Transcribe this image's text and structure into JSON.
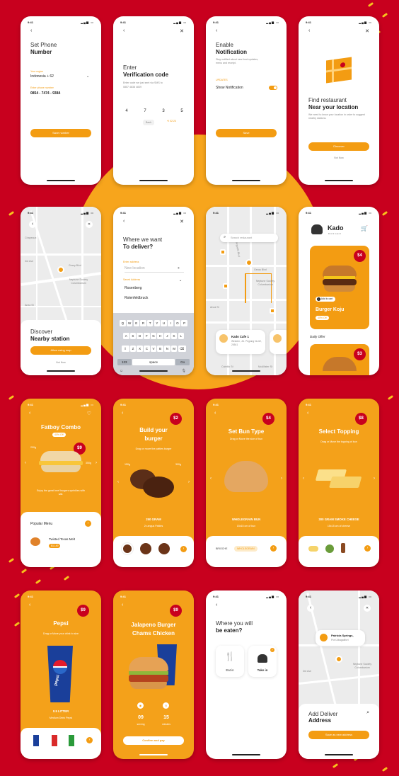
{
  "colors": {
    "background": "#c8001e",
    "accent": "#f39c12",
    "sun": "#f7a51c"
  },
  "status_time": "9:41",
  "p1": {
    "title1": "Set Phone",
    "title2": "Number",
    "region_label": "Your region",
    "region_value": "Indonesia + 62",
    "phone_label": "Enter phone number",
    "phone_value": "0854 - 7474 - 9384",
    "button": "Save number"
  },
  "p2": {
    "title1": "Enter",
    "title2": "Verification code",
    "desc": "Enter code we just sent via SMS to",
    "phone": "0857 4838 4839",
    "digits": [
      "4",
      "7",
      "3",
      "5"
    ],
    "back": "Back",
    "timer": "02:24"
  },
  "p3": {
    "title1": "Enable",
    "title2": "Notification",
    "desc": "Stay notified about new food updates, menu and receipt.",
    "section": "UPDATES",
    "toggle_label": "Show Notification",
    "button": "Save"
  },
  "p4": {
    "title1": "Find restaurant",
    "title2": "Near your location",
    "desc": "We need to know your location in order to suggest nearby stations.",
    "button": "Discover",
    "link": "Not Now"
  },
  "p5": {
    "streets": [
      "Chapeaux",
      "Geary Blvd",
      "Neptune Society Columbarium",
      "3rd Ave",
      "2nd Ave",
      "Anza St"
    ],
    "title1": "Discover",
    "title2": "Nearby station",
    "button": "Allow using map",
    "link": "Not Now"
  },
  "p6": {
    "title1": "Where we want",
    "title2": "To deliver?",
    "address_label": "Enter address",
    "address_placeholder": "New location",
    "saved_label": "Saved Address",
    "saved": [
      "Rosenberg",
      "Rstenfeldbruck"
    ],
    "rows": [
      "QWERTYUIOP",
      "ASDFGHJKL",
      "ZXCVBNM"
    ],
    "k123": "123",
    "space": "space",
    "go": "Go"
  },
  "p7": {
    "search_placeholder": "Search restaurant",
    "streets": [
      "Arguello Blvd",
      "Geary Blvd",
      "Neptune Society Columbarium",
      "Anza St",
      "Cabrillo St",
      "McAllister St",
      "Edward St"
    ],
    "card_title": "Kado Cafe 1",
    "card_address": "Western, Jln. Pegiung No.62, 24541"
  },
  "p8": {
    "brand": "Kado",
    "brand_sub": "BURGER",
    "price1": "$4",
    "add": "Add to cart",
    "name": "Burger Koju",
    "discount": "40% Off",
    "section": "Daily Offer",
    "price2": "$3"
  },
  "p9": {
    "title": "Fatboy Combo",
    "discount": "40% Off",
    "price": "$9",
    "size_left": "200g",
    "size_right": "350g",
    "desc": "Enjoy the great beef burgers sprinkles with salt.",
    "popular": "Popular Menu",
    "item_name": "Twisted Texas Melt",
    "item_price": "$11.49"
  },
  "p10": {
    "price": "$2",
    "title1": "Build your",
    "title2": "burger",
    "desc": "Drag or move the patties burger",
    "size_left": "150g",
    "size_right": "300g",
    "name": "250 GRAM",
    "info": "2x angus Patties"
  },
  "p11": {
    "price": "$4",
    "title": "Set Bun Type",
    "desc": "Drag or Move the size of bun",
    "name": "WHOLEGRAIN BUN",
    "info": "15x15 cm of bun",
    "opt1": "BRIOCHE",
    "opt2": "WHOLEGRAIN"
  },
  "p12": {
    "price": "$8",
    "title": "Select Topping",
    "desc": "Drag or Move the topping of bun",
    "name": "300 GRAM SMOKE CHEESE",
    "info": "15x15 cm of cheese"
  },
  "p13": {
    "price": "$9",
    "title": "Pepsi",
    "desc": "Drag or Move your drink to size",
    "name": "0.5 LITTER",
    "info": "Medium Drink Pepsi",
    "brand": "pepsi"
  },
  "p14": {
    "price": "$9",
    "title1": "Jalapeno Burger",
    "title2": "Chams Chicken",
    "n1": "09",
    "l1": "serving",
    "n2": "15",
    "l2": "minutes",
    "button": "Confirm and pay"
  },
  "p15": {
    "title1": "Where you will",
    "title2": "be eaten?",
    "opt1": "Eat in",
    "opt2": "Take in"
  },
  "p16": {
    "popup_title": "Patricia Springs,",
    "popup_sub": "Port Abagailfort",
    "streets": [
      "Neptune Society Columbarium",
      "3rd Ave"
    ],
    "title1": "Add Deliver",
    "title2": "Address",
    "button": "Save as new address"
  }
}
